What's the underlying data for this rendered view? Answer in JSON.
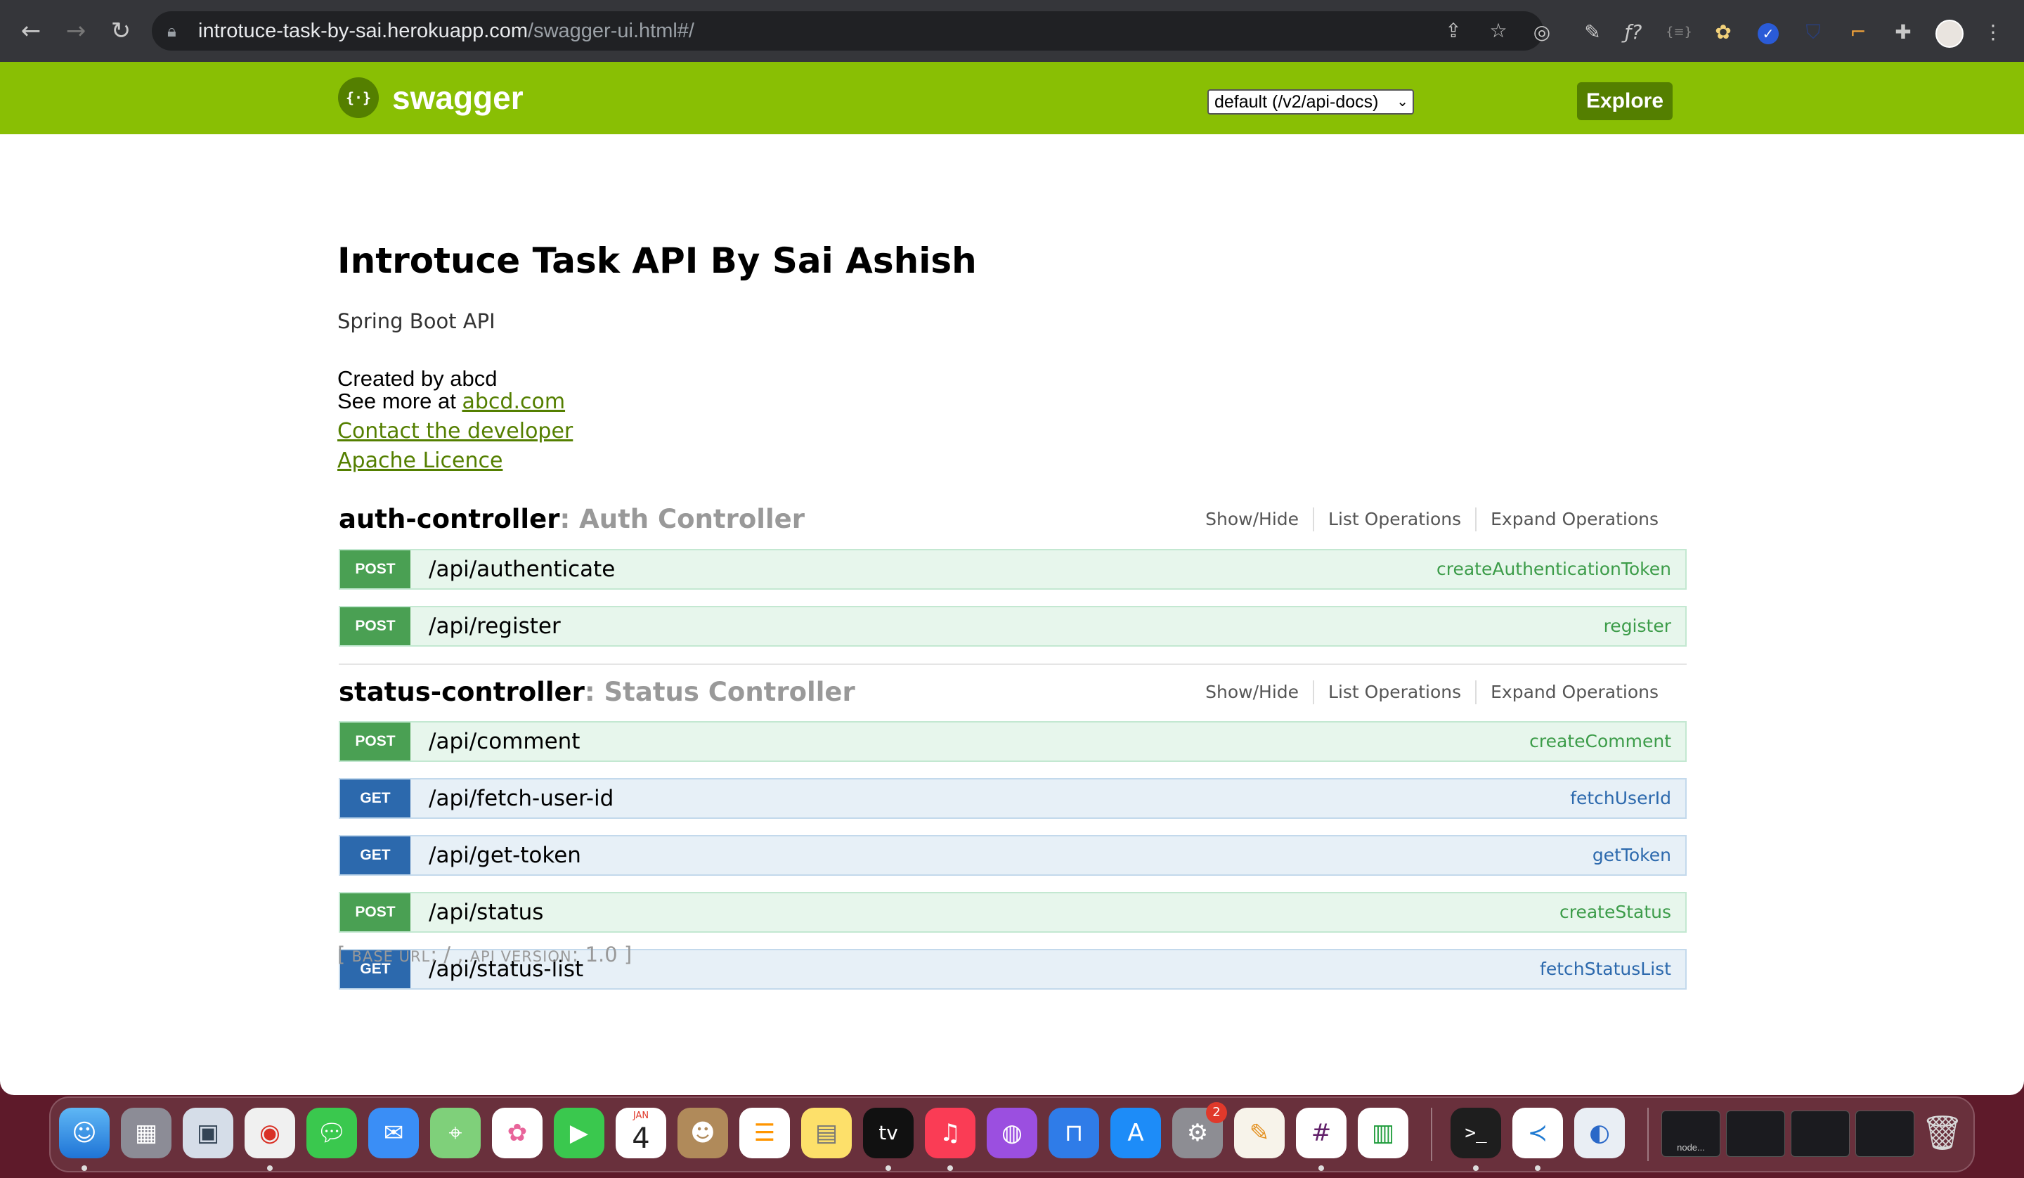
{
  "browser": {
    "url_host": "introtuce-task-by-sai.herokuapp.com",
    "url_path": "/swagger-ui.html#/",
    "nav_icons": [
      "back-arrow-icon",
      "forward-arrow-icon",
      "reload-icon"
    ],
    "omnibox_icons": [
      "lock-icon",
      "share-icon",
      "bookmark-star-icon"
    ],
    "extension_icons": [
      "target-extension-icon",
      "pen-extension-icon",
      "formula-extension-icon",
      "brackets-extension-icon",
      "flower-extension-icon",
      "check-extension-icon",
      "shield-extension-icon",
      "ruler-extension-icon",
      "puzzle-extensions-icon",
      "profile-avatar",
      "menu-kebab-icon"
    ]
  },
  "swagger": {
    "logo_text": "swagger",
    "logo_glyph": "{·}",
    "spec_select": "default (/v2/api-docs)",
    "explore_label": "Explore",
    "header_color": "#89bf04"
  },
  "info": {
    "title": "Introtuce Task API By Sai Ashish",
    "description": "Spring Boot API",
    "created_by": "Created by abcd",
    "see_more_prefix": "See more at ",
    "see_more_link": "abcd.com",
    "contact_link": "Contact the developer",
    "license_link": "Apache Licence"
  },
  "controller_ops": {
    "show_hide": "Show/Hide",
    "list_operations": "List Operations",
    "expand_operations": "Expand Operations"
  },
  "controllers": [
    {
      "name": "auth-controller",
      "description": ": Auth Controller",
      "operations": [
        {
          "method": "POST",
          "path": "/api/authenticate",
          "nickname": "createAuthenticationToken"
        },
        {
          "method": "POST",
          "path": "/api/register",
          "nickname": "register"
        }
      ]
    },
    {
      "name": "status-controller",
      "description": ": Status Controller",
      "operations": [
        {
          "method": "POST",
          "path": "/api/comment",
          "nickname": "createComment"
        },
        {
          "method": "GET",
          "path": "/api/fetch-user-id",
          "nickname": "fetchUserId"
        },
        {
          "method": "GET",
          "path": "/api/get-token",
          "nickname": "getToken"
        },
        {
          "method": "POST",
          "path": "/api/status",
          "nickname": "createStatus"
        },
        {
          "method": "GET",
          "path": "/api/status-list",
          "nickname": "fetchStatusList"
        }
      ]
    }
  ],
  "footer": {
    "open": "[ ",
    "base_url_label": "Base URL",
    "base_url_value": ": / , ",
    "api_version_label": "Api Version",
    "api_version_value": ": 1.0 ]"
  },
  "dock": {
    "apps": [
      "finder-icon",
      "launchpad-icon",
      "preview-icon",
      "chrome-icon",
      "messages-icon",
      "mail-icon",
      "maps-icon",
      "photos-icon",
      "facetime-icon",
      "calendar-icon",
      "contacts-icon",
      "reminders-icon",
      "notes-icon",
      "apple-tv-icon",
      "music-icon",
      "podcasts-icon",
      "keynote-icon",
      "app-store-icon",
      "system-preferences-icon",
      "pages-icon",
      "slack-icon",
      "numbers-icon",
      "terminal-icon",
      "vscode-icon",
      "proxyman-icon"
    ],
    "calendar_month": "JAN",
    "calendar_day": "4",
    "appletv_label": "tv",
    "settings_badge": "2",
    "thumbnail_label": "node...",
    "trash": "trash-icon"
  }
}
